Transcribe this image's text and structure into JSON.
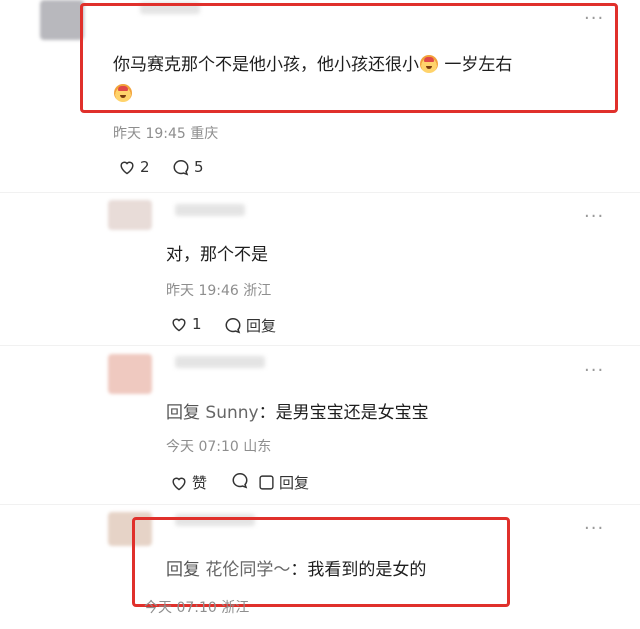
{
  "comments": [
    {
      "text_part1": "你马赛克那个不是他小孩，他小孩还很小",
      "text_part2": " 一岁左右",
      "emoji_name": "crying-face-emoji",
      "time": "昨天 19:45",
      "location": "重庆",
      "likes": "2",
      "replies": "5"
    },
    {
      "text": "对，那个不是",
      "time": "昨天 19:46",
      "location": "浙江",
      "likes": "1",
      "reply_label": "回复"
    },
    {
      "reply_prefix": "回复",
      "reply_to": "Sunny",
      "text": "：是男宝宝还是女宝宝",
      "time": "今天 07:10",
      "location": "山东",
      "like_label": "赞",
      "reply_label": "回复"
    },
    {
      "reply_prefix": "回复",
      "reply_to": "花伦同学～",
      "text": "：我看到的是女的",
      "time": "今天 07:10",
      "location": "浙江"
    }
  ],
  "colors": {
    "highlight_box": "#e0302b",
    "meta_text": "#8e8e8e"
  }
}
